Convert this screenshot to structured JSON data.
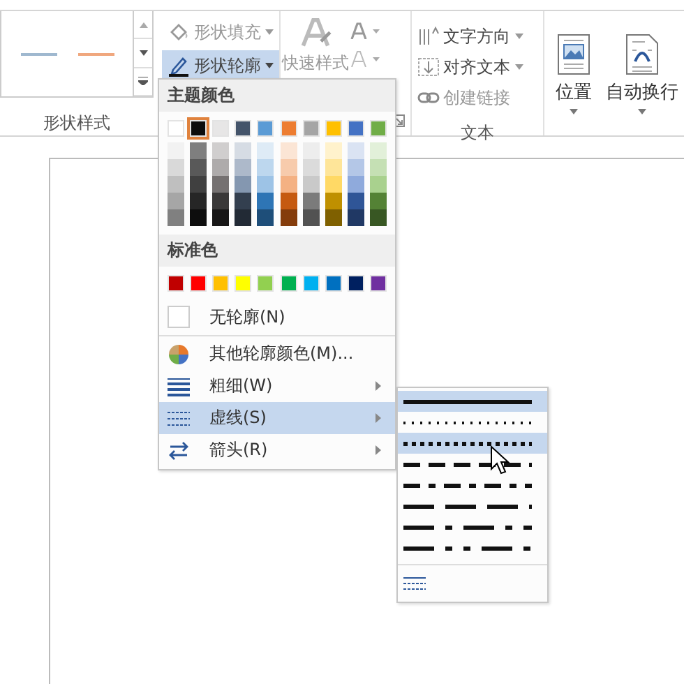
{
  "ribbon": {
    "gallery": {
      "samples": [
        {
          "color": "#9fb8cf"
        },
        {
          "color": "#f0a77e"
        }
      ]
    },
    "fill_button": {
      "label": "形状填充",
      "disabled": true
    },
    "outline_button": {
      "label": "形状轮廓",
      "selected": true
    },
    "quick_styles": {
      "label": "快速样式"
    },
    "group_label_1": "形状样式",
    "text_direction": {
      "label": "文字方向",
      "disabled": false
    },
    "align_text": {
      "label": "对齐文本",
      "disabled": false
    },
    "create_link": {
      "label": "创建链接",
      "disabled": true
    },
    "group_label_3": "文本",
    "position": {
      "label": "位置"
    },
    "wrap_text": {
      "label": "自动换行"
    }
  },
  "menu": {
    "theme_header": "主题颜色",
    "theme_colors": [
      {
        "color": "#ffffff",
        "selected": false,
        "shades": [
          {
            "color": "#f2f2f2"
          },
          {
            "color": "#d9d9d9"
          },
          {
            "color": "#bfbfbf"
          },
          {
            "color": "#a6a6a6"
          },
          {
            "color": "#808080"
          }
        ]
      },
      {
        "color": "#0d0d0d",
        "selected": true,
        "shades": [
          {
            "color": "#7f7f7f"
          },
          {
            "color": "#595959"
          },
          {
            "color": "#404040"
          },
          {
            "color": "#262626"
          },
          {
            "color": "#0d0d0d"
          }
        ]
      },
      {
        "color": "#e7e6e6",
        "selected": false,
        "shades": [
          {
            "color": "#d0cece"
          },
          {
            "color": "#aeabab"
          },
          {
            "color": "#757171"
          },
          {
            "color": "#3a3838"
          },
          {
            "color": "#171616"
          }
        ]
      },
      {
        "color": "#44546a",
        "selected": false,
        "shades": [
          {
            "color": "#d6dce4"
          },
          {
            "color": "#adb9ca"
          },
          {
            "color": "#8497b0"
          },
          {
            "color": "#333f4f"
          },
          {
            "color": "#222a35"
          }
        ]
      },
      {
        "color": "#5b9bd5",
        "selected": false,
        "shades": [
          {
            "color": "#deebf6"
          },
          {
            "color": "#bdd7ee"
          },
          {
            "color": "#9dc3e6"
          },
          {
            "color": "#2e75b5"
          },
          {
            "color": "#1e4e79"
          }
        ]
      },
      {
        "color": "#ed7d31",
        "selected": false,
        "shades": [
          {
            "color": "#fbe5d5"
          },
          {
            "color": "#f7cbac"
          },
          {
            "color": "#f4b183"
          },
          {
            "color": "#c55a11"
          },
          {
            "color": "#843c0b"
          }
        ]
      },
      {
        "color": "#a5a5a5",
        "selected": false,
        "shades": [
          {
            "color": "#ededed"
          },
          {
            "color": "#dbdbdb"
          },
          {
            "color": "#c9c9c9"
          },
          {
            "color": "#7b7b7b"
          },
          {
            "color": "#525252"
          }
        ]
      },
      {
        "color": "#ffc000",
        "selected": false,
        "shades": [
          {
            "color": "#fff2cc"
          },
          {
            "color": "#fee599"
          },
          {
            "color": "#ffd965"
          },
          {
            "color": "#bf9000"
          },
          {
            "color": "#7f6000"
          }
        ]
      },
      {
        "color": "#4472c4",
        "selected": false,
        "shades": [
          {
            "color": "#dae3f3"
          },
          {
            "color": "#b4c7e7"
          },
          {
            "color": "#8faadc"
          },
          {
            "color": "#2f5597"
          },
          {
            "color": "#203864"
          }
        ]
      },
      {
        "color": "#70ad47",
        "selected": false,
        "shades": [
          {
            "color": "#e2f0d9"
          },
          {
            "color": "#c5e0b4"
          },
          {
            "color": "#a9d18e"
          },
          {
            "color": "#548235"
          },
          {
            "color": "#385723"
          }
        ]
      }
    ],
    "standard_header": "标准色",
    "standard_colors": [
      {
        "color": "#c00000"
      },
      {
        "color": "#ff0000"
      },
      {
        "color": "#ffc000"
      },
      {
        "color": "#ffff00"
      },
      {
        "color": "#92d050"
      },
      {
        "color": "#00b050"
      },
      {
        "color": "#00b0f0"
      },
      {
        "color": "#0070c0"
      },
      {
        "color": "#002060"
      },
      {
        "color": "#7030a0"
      }
    ],
    "no_outline": "无轮廓(N)",
    "items": [
      {
        "kind": "palette",
        "label": "其他轮廓颜色(M)...",
        "submenu": false,
        "selected": false
      },
      {
        "kind": "weight",
        "label": "粗细(W)",
        "submenu": true,
        "selected": false
      },
      {
        "kind": "dash",
        "label": "虚线(S)",
        "submenu": true,
        "selected": true
      },
      {
        "kind": "arrows",
        "label": "箭头(R)",
        "submenu": true,
        "selected": false
      }
    ]
  },
  "dash_menu": {
    "styles": [
      {
        "kind": "solid",
        "highlighted": true
      },
      {
        "kind": "round-dot",
        "highlighted": false
      },
      {
        "kind": "square-dot",
        "highlighted": true
      },
      {
        "kind": "dash",
        "highlighted": false
      },
      {
        "kind": "dash-dot",
        "highlighted": false
      },
      {
        "kind": "long-dash",
        "highlighted": false
      },
      {
        "kind": "long-dash-dot",
        "highlighted": false
      },
      {
        "kind": "long-dash-dot-dot",
        "highlighted": false
      }
    ]
  }
}
